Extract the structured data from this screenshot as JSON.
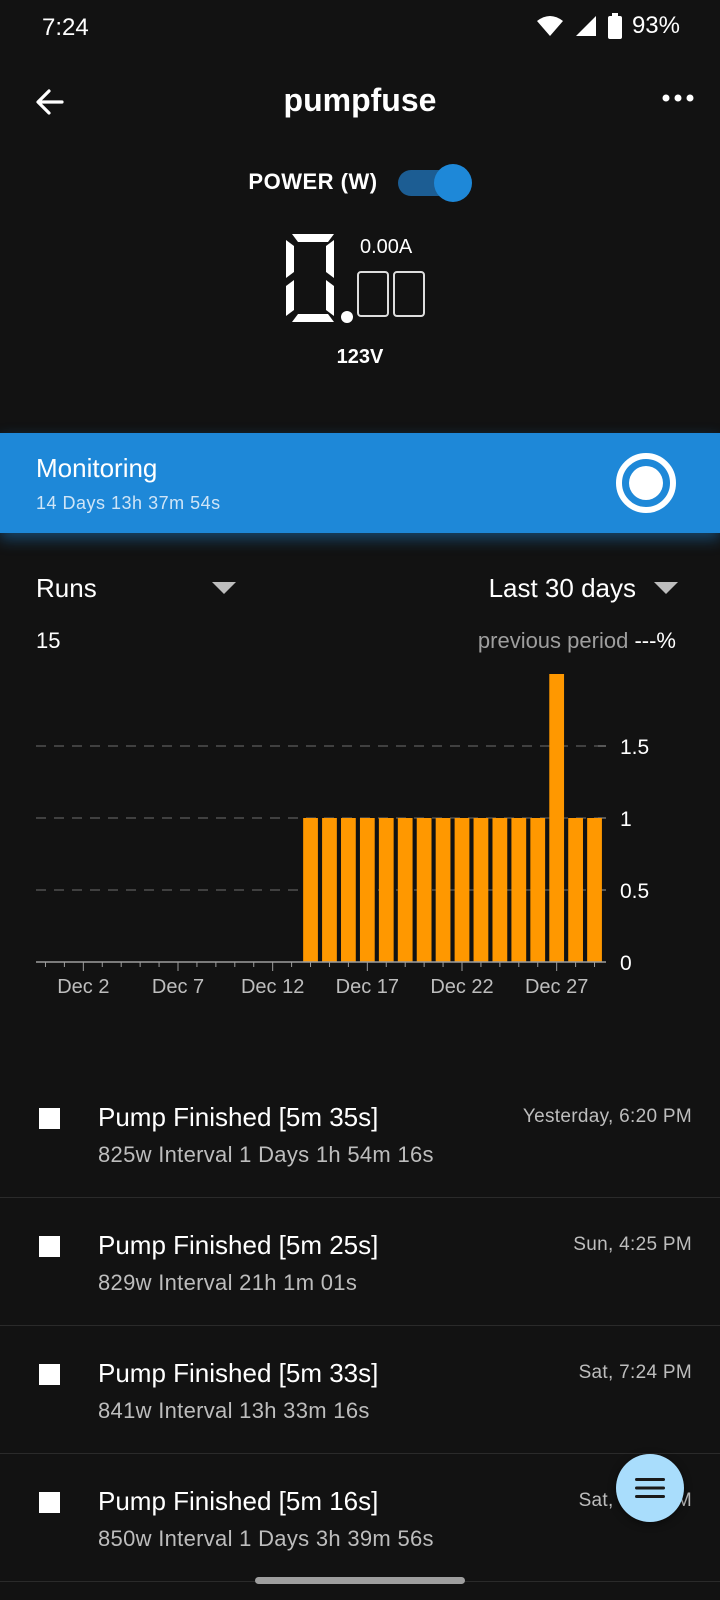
{
  "status_bar": {
    "time": "7:24",
    "battery": "93%"
  },
  "app_bar": {
    "title": "pumpfuse"
  },
  "power": {
    "label": "POWER (W)",
    "toggle_on": true,
    "amps": "0.00A",
    "watts_display": "0.00",
    "voltage": "123V"
  },
  "monitoring": {
    "title": "Monitoring",
    "duration": "14 Days 13h 37m 54s"
  },
  "filters": {
    "metric": "Runs",
    "range": "Last 30 days"
  },
  "summary": {
    "count": "15",
    "previous_label": "previous period",
    "previous_value": "---%"
  },
  "chart_data": {
    "type": "bar",
    "categories": [
      "Dec 14",
      "Dec 15",
      "Dec 16",
      "Dec 17",
      "Dec 18",
      "Dec 19",
      "Dec 20",
      "Dec 21",
      "Dec 22",
      "Dec 23",
      "Dec 24",
      "Dec 25",
      "Dec 26",
      "Dec 27",
      "Dec 28",
      "Dec 29"
    ],
    "values": [
      1,
      1,
      1,
      1,
      1,
      1,
      1,
      1,
      1,
      1,
      1,
      1,
      1,
      2,
      1,
      1
    ],
    "x_tick_labels": [
      "Dec 2",
      "Dec 7",
      "Dec 12",
      "Dec 17",
      "Dec 22",
      "Dec 27"
    ],
    "y_tick_labels": [
      "0",
      "0.5",
      "1",
      "1.5"
    ],
    "y_ticks": [
      0,
      0.5,
      1,
      1.5
    ],
    "ylim": [
      0,
      2
    ],
    "x_range_days": [
      "Nov 30",
      "Dec 29"
    ],
    "bar_color": "#ff9800",
    "grid": "dashed horizontal",
    "title": "",
    "xlabel": "",
    "ylabel": ""
  },
  "events": [
    {
      "title": "Pump Finished [5m 35s]",
      "detail": "825w Interval 1 Days 1h 54m 16s",
      "time": "Yesterday, 6:20 PM"
    },
    {
      "title": "Pump Finished [5m 25s]",
      "detail": "829w Interval 21h 1m 01s",
      "time": "Sun, 4:25 PM"
    },
    {
      "title": "Pump Finished [5m 33s]",
      "detail": "841w Interval 13h 33m 16s",
      "time": "Sat, 7:24 PM"
    },
    {
      "title": "Pump Finished [5m 16s]",
      "detail": "850w Interval 1 Days 3h 39m 56s",
      "time": "Sat, 5:20 PM"
    }
  ],
  "colors": {
    "accent": "#1e88d8",
    "bar": "#ff9800",
    "fab": "#a9ddfc"
  },
  "icons": {
    "back": "arrow-left-icon",
    "more": "more-horizontal-icon",
    "monitor": "radio-ring-icon",
    "fab": "menu-icon"
  }
}
